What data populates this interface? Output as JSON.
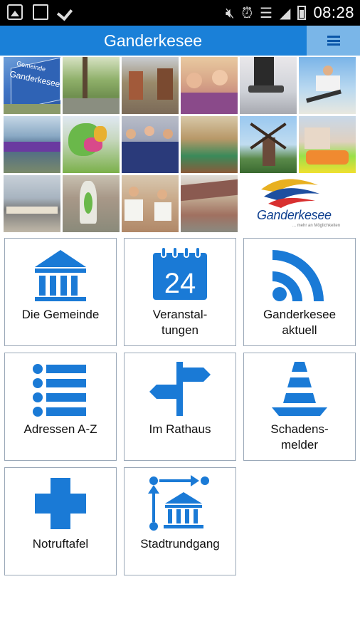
{
  "status_bar": {
    "time": "08:28",
    "icons": [
      "gallery-icon",
      "screenshot-icon",
      "check-icon",
      "mute-icon",
      "alarm-icon",
      "wifi-icon",
      "signal-icon",
      "battery-icon"
    ]
  },
  "app_bar": {
    "title": "Ganderkesee",
    "menu_icon": "hamburger-menu-icon"
  },
  "gallery": {
    "logo_text": "Ganderkesee",
    "logo_subtext": "... mehr an Möglichkeiten",
    "sign_text_1": "Gemeinde",
    "sign_text_2": "Ganderkesee"
  },
  "tiles": [
    {
      "label": "Die Gemeinde",
      "icon": "town-hall-icon"
    },
    {
      "label": "Veranstal-\ntungen",
      "icon": "calendar-24-icon"
    },
    {
      "label": "Ganderkesee\naktuell",
      "icon": "rss-feed-icon"
    },
    {
      "label": "Adressen A-Z",
      "icon": "list-icon"
    },
    {
      "label": "Im Rathaus",
      "icon": "signpost-icon"
    },
    {
      "label": "Schadens-\nmelder",
      "icon": "traffic-cone-icon"
    },
    {
      "label": "Notruftafel",
      "icon": "medical-cross-icon"
    },
    {
      "label": "Stadtrundgang",
      "icon": "city-tour-icon"
    }
  ],
  "calendar_number": "24",
  "colors": {
    "primary": "#1a80d8",
    "menu_button": "#7ab6e8",
    "icon": "#1a7ad6",
    "status_bar": "#000000"
  }
}
